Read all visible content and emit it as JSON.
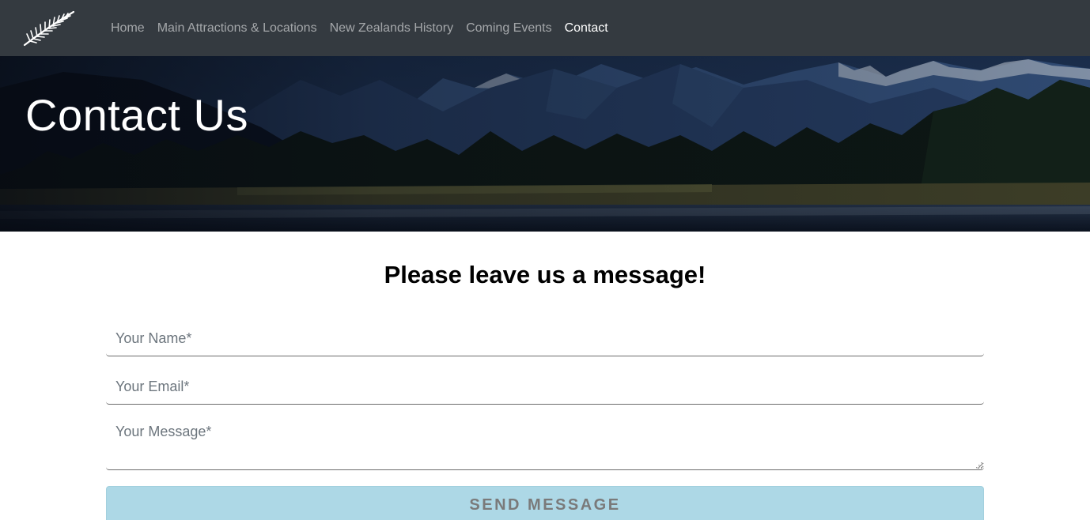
{
  "nav": {
    "logo_icon": "silver-fern-icon",
    "links": [
      {
        "label": "Home",
        "active": false
      },
      {
        "label": "Main Attractions & Locations",
        "active": false
      },
      {
        "label": "New Zealands History",
        "active": false
      },
      {
        "label": "Coming Events",
        "active": false
      },
      {
        "label": "Contact",
        "active": true
      }
    ]
  },
  "hero": {
    "title": "Contact Us"
  },
  "form": {
    "heading": "Please leave us a message!",
    "name_placeholder": "Your Name*",
    "email_placeholder": "Your Email*",
    "message_placeholder": "Your Message*",
    "submit_label": "SEND MESSAGE"
  },
  "colors": {
    "navbar": "#343a40",
    "nav_link": "rgba(255,255,255,0.55)",
    "nav_link_active": "#ffffff",
    "button_bg": "#add8e6",
    "button_text": "#7a7a7a"
  }
}
